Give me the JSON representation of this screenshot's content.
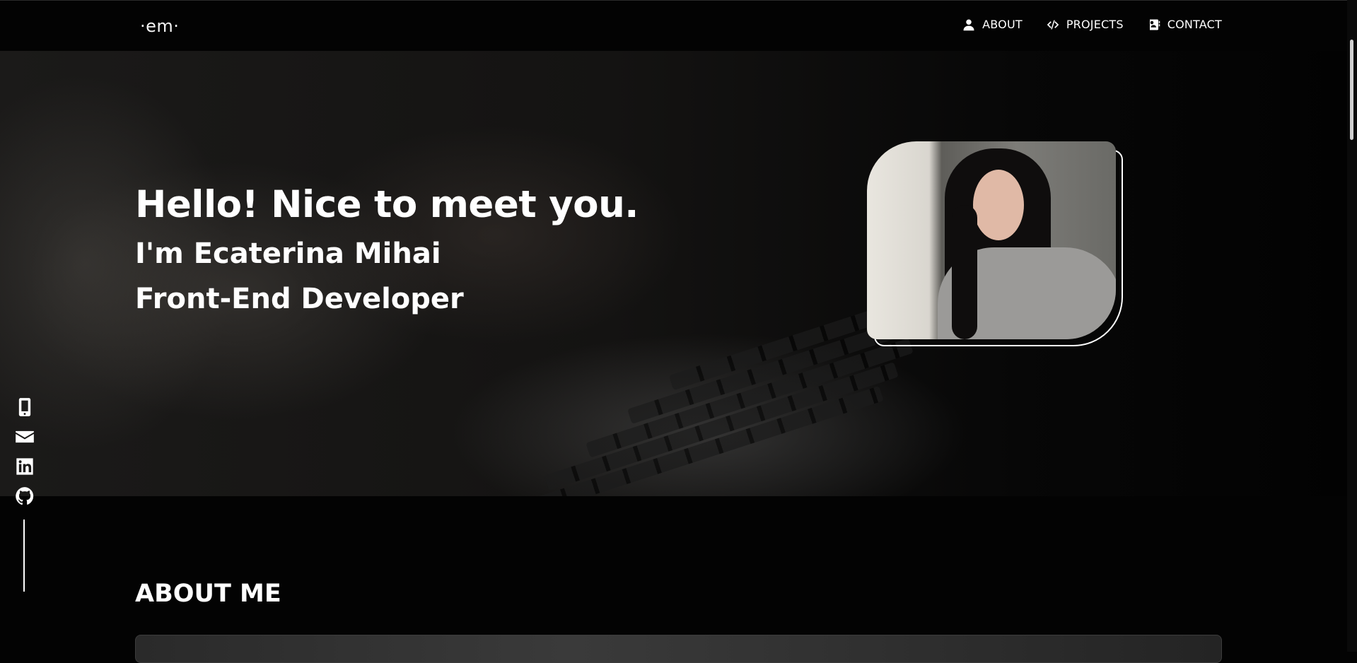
{
  "brand": {
    "logo": "·em·"
  },
  "nav": {
    "items": [
      {
        "label": "ABOUT",
        "icon": "user-icon"
      },
      {
        "label": "PROJECTS",
        "icon": "code-icon"
      },
      {
        "label": "CONTACT",
        "icon": "address-book-icon"
      }
    ]
  },
  "hero": {
    "greeting": "Hello! Nice to meet you.",
    "name_line": "I'm Ecaterina Mihai",
    "role_line": "Front-End Developer"
  },
  "social": {
    "items": [
      {
        "icon": "mobile-phone-icon"
      },
      {
        "icon": "envelope-icon"
      },
      {
        "icon": "linkedin-icon"
      },
      {
        "icon": "github-icon"
      }
    ]
  },
  "about": {
    "heading": "ABOUT ME"
  },
  "colors": {
    "background": "#030303",
    "text": "#ffffff"
  }
}
